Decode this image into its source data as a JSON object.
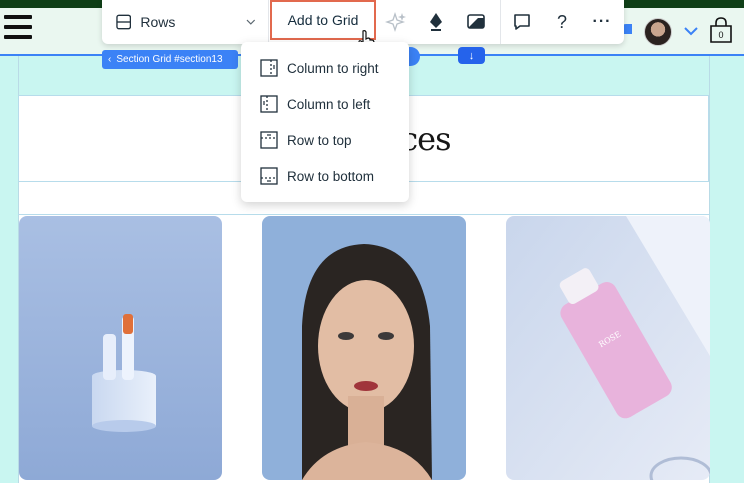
{
  "toolbar": {
    "layout_label": "Rows",
    "add_to_grid_label": "Add to Grid"
  },
  "breadcrumb": {
    "label": "Section Grid #section13"
  },
  "down_arrow": "↓",
  "help_label": "?",
  "more_label": "···",
  "dropdown": {
    "items": [
      {
        "label": "Column to right"
      },
      {
        "label": "Column to left"
      },
      {
        "label": "Row to top"
      },
      {
        "label": "Row to bottom"
      }
    ]
  },
  "page": {
    "title_fragment": "ices"
  },
  "colors": {
    "accent": "#3b82f6",
    "highlight_border": "#e2694e",
    "canvas": "#c9f6f1",
    "top_strip": "#0f3f17"
  }
}
